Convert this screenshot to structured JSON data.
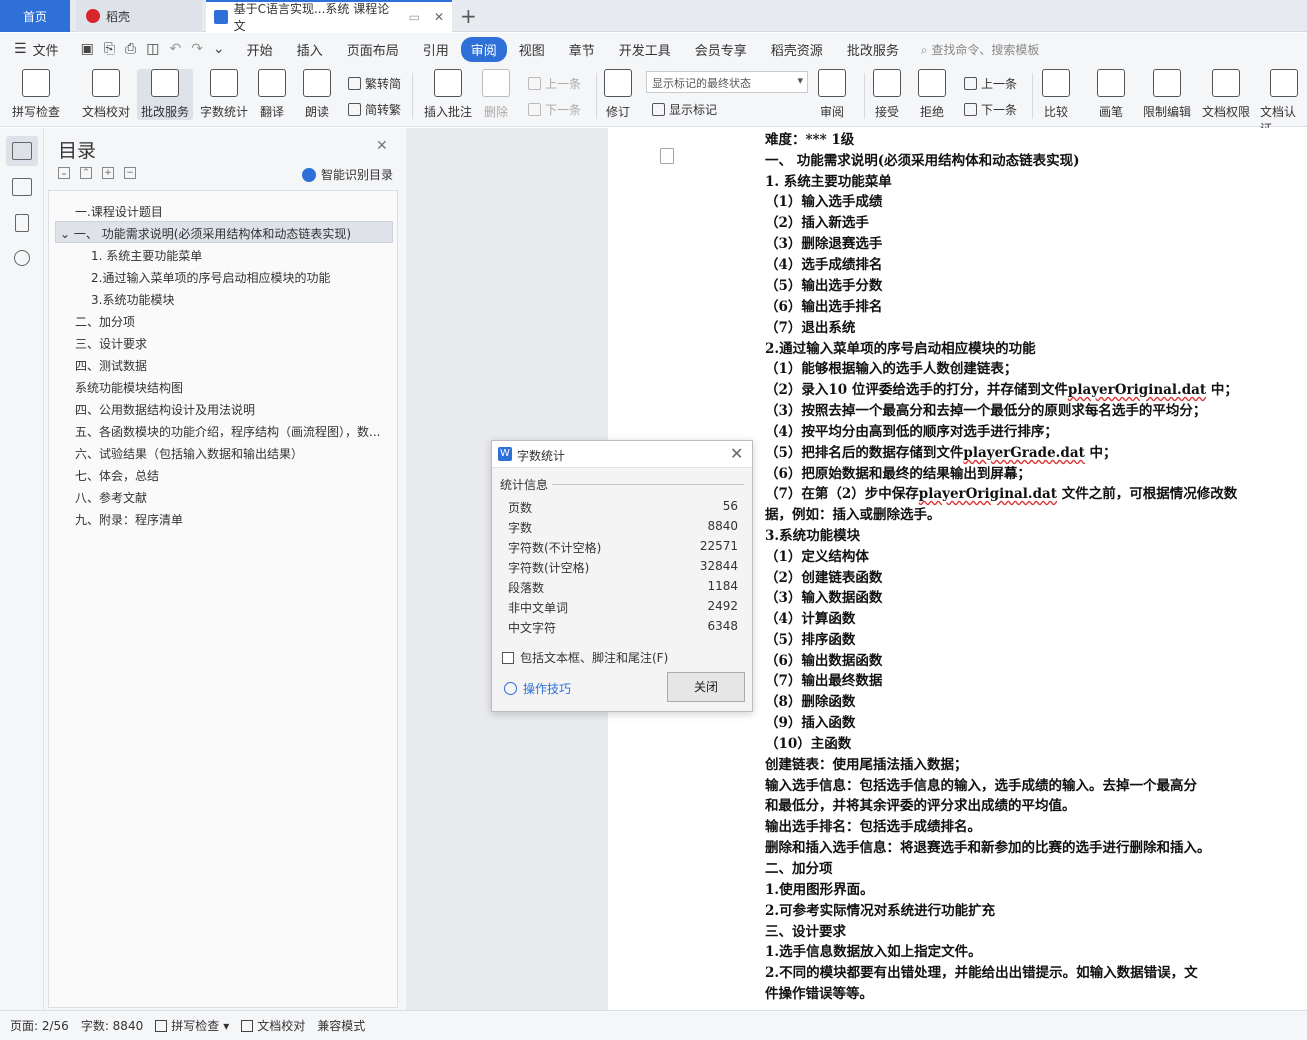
{
  "tabs": {
    "home": "首页",
    "daoke": "稻壳",
    "doc": "基于C语言实现...系统 课程论文"
  },
  "menu": {
    "file": "文件",
    "items": [
      "开始",
      "插入",
      "页面布局",
      "引用",
      "审阅",
      "视图",
      "章节",
      "开发工具",
      "会员专享",
      "稻壳资源",
      "批改服务"
    ],
    "active": "审阅",
    "search": "查找命令、搜索模板"
  },
  "ribbon": {
    "spell": "拼写检查",
    "proof": "文档校对",
    "review_service": "批改服务",
    "word_count": "字数统计",
    "translate": "翻译",
    "read_aloud": "朗读",
    "to_trad": "繁转简",
    "to_simp": "简转繁",
    "insert_comment": "插入批注",
    "delete": "删除",
    "prev": "上一条",
    "next": "下一条",
    "revise": "修订",
    "mark_state": "显示标记的最终状态",
    "show_marks": "显示标记",
    "review": "审阅",
    "accept": "接受",
    "reject": "拒绝",
    "prev2": "上一条",
    "next2": "下一条",
    "compare": "比较",
    "pen": "画笔",
    "restrict": "限制编辑",
    "permission": "文档权限",
    "certify": "文档认证"
  },
  "toc": {
    "title": "目录",
    "smart": "智能识别目录",
    "items": [
      "一.课程设计题目",
      "一、 功能需求说明(必须采用结构体和动态链表实现)",
      "1. 系统主要功能菜单",
      "2.通过输入菜单项的序号启动相应模块的功能",
      "3.系统功能模块",
      "二、加分项",
      "三、设计要求",
      "四、测试数据",
      "系统功能模块结构图",
      "四、公用数据结构设计及用法说明",
      "五、各函数模块的功能介绍，程序结构（画流程图），数...",
      "六、试验结果（包括输入数据和输出结果）",
      "七、体会，总结",
      "八、参考文献",
      "九、附录：程序清单"
    ]
  },
  "dialog": {
    "title": "字数统计",
    "section": "统计信息",
    "stats": [
      {
        "label": "页数",
        "value": "56"
      },
      {
        "label": "字数",
        "value": "8840"
      },
      {
        "label": "字符数(不计空格)",
        "value": "22571"
      },
      {
        "label": "字符数(计空格)",
        "value": "32844"
      },
      {
        "label": "段落数",
        "value": "1184"
      },
      {
        "label": "非中文单词",
        "value": "2492"
      },
      {
        "label": "中文字符",
        "value": "6348"
      }
    ],
    "include": "包括文本框、脚注和尾注(F)",
    "tips": "操作技巧",
    "close": "关闭"
  },
  "document": {
    "lines": [
      "难度：*** 1级",
      "一、 功能需求说明(必须采用结构体和动态链表实现)",
      "1. 系统主要功能菜单",
      "（1）输入选手成绩",
      "（2）插入新选手",
      "（3）删除退赛选手",
      "（4）选手成绩排名",
      "（5）输出选手分数",
      "（6）输出选手排名",
      "（7）退出系统",
      "2.通过输入菜单项的序号启动相应模块的功能",
      "（1）能够根据输入的选手人数创建链表；",
      "（2）录入10 位评委给选手的打分，并存储到文件playerOriginal.dat 中；",
      "（3）按照去掉一个最高分和去掉一个最低分的原则求每名选手的平均分；",
      "（4）按平均分由高到低的顺序对选手进行排序；",
      "（5）把排名后的数据存储到文件playerGrade.dat 中；",
      "（6）把原始数据和最终的结果输出到屏幕；",
      "（7）在第（2）步中保存playerOriginal.dat 文件之前，可根据情况修改数",
      "据，例如：插入或删除选手。",
      "3.系统功能模块",
      "（1）定义结构体",
      "（2）创建链表函数",
      "（3）输入数据函数",
      "（4）计算函数",
      "（5）排序函数",
      "（6）输出数据函数",
      "（7）输出最终数据",
      "（8）删除函数",
      "（9）插入函数",
      "（10）主函数",
      "创建链表：使用尾插法插入数据；",
      "输入选手信息：包括选手信息的输入，选手成绩的输入。去掉一个最高分",
      "和最低分，并将其余评委的评分求出成绩的平均值。",
      "输出选手排名：包括选手成绩排名。",
      "删除和插入选手信息：将退赛选手和新参加的比赛的选手进行删除和插入。",
      "二、加分项",
      "1.使用图形界面。",
      "2.可参考实际情况对系统进行功能扩充",
      "三、设计要求",
      "1.选手信息数据放入如上指定文件。",
      "2.不同的模块都要有出错处理，并能给出出错提示。如输入数据错误，文",
      "件操作错误等等。"
    ]
  },
  "status": {
    "page": "页面: 2/56",
    "words": "字数: 8840",
    "spell": "拼写检查",
    "proof": "文档校对",
    "compat": "兼容模式"
  }
}
